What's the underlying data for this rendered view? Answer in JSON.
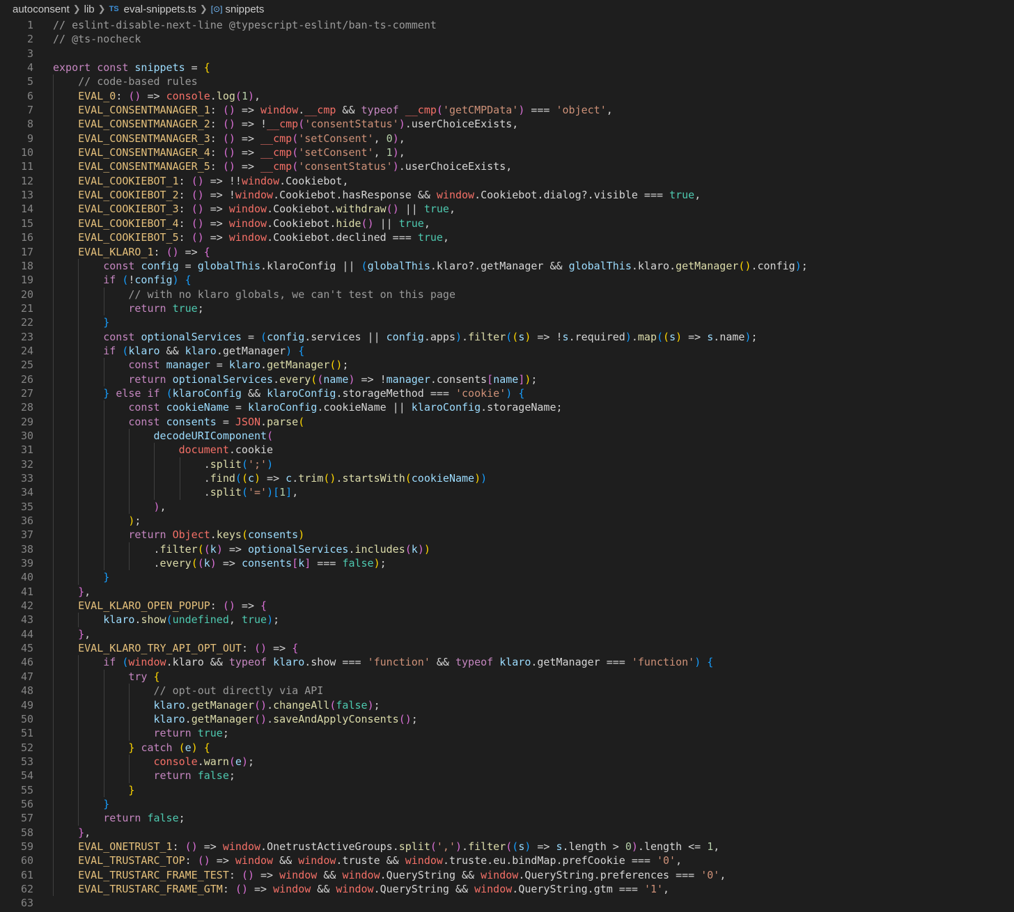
{
  "breadcrumb": {
    "items": [
      "autoconsent",
      "lib",
      "eval-snippets.ts",
      "snippets"
    ],
    "file_icon": "TS",
    "symbol_icon": "[⊙]"
  },
  "code_lines": [
    "// eslint-disable-next-line @typescript-eslint/ban-ts-comment",
    "// @ts-nocheck",
    "",
    "export const snippets = {",
    "    // code-based rules",
    "    EVAL_0: () => console.log(1),",
    "    EVAL_CONSENTMANAGER_1: () => window.__cmp && typeof __cmp('getCMPData') === 'object',",
    "    EVAL_CONSENTMANAGER_2: () => !__cmp('consentStatus').userChoiceExists,",
    "    EVAL_CONSENTMANAGER_3: () => __cmp('setConsent', 0),",
    "    EVAL_CONSENTMANAGER_4: () => __cmp('setConsent', 1),",
    "    EVAL_CONSENTMANAGER_5: () => __cmp('consentStatus').userChoiceExists,",
    "    EVAL_COOKIEBOT_1: () => !!window.Cookiebot,",
    "    EVAL_COOKIEBOT_2: () => !window.Cookiebot.hasResponse && window.Cookiebot.dialog?.visible === true,",
    "    EVAL_COOKIEBOT_3: () => window.Cookiebot.withdraw() || true,",
    "    EVAL_COOKIEBOT_4: () => window.Cookiebot.hide() || true,",
    "    EVAL_COOKIEBOT_5: () => window.Cookiebot.declined === true,",
    "    EVAL_KLARO_1: () => {",
    "        const config = globalThis.klaroConfig || (globalThis.klaro?.getManager && globalThis.klaro.getManager().config);",
    "        if (!config) {",
    "            // with no klaro globals, we can't test on this page",
    "            return true;",
    "        }",
    "        const optionalServices = (config.services || config.apps).filter((s) => !s.required).map((s) => s.name);",
    "        if (klaro && klaro.getManager) {",
    "            const manager = klaro.getManager();",
    "            return optionalServices.every((name) => !manager.consents[name]);",
    "        } else if (klaroConfig && klaroConfig.storageMethod === 'cookie') {",
    "            const cookieName = klaroConfig.cookieName || klaroConfig.storageName;",
    "            const consents = JSON.parse(",
    "                decodeURIComponent(",
    "                    document.cookie",
    "                        .split(';')",
    "                        .find((c) => c.trim().startsWith(cookieName))",
    "                        .split('=')[1],",
    "                ),",
    "            );",
    "            return Object.keys(consents)",
    "                .filter((k) => optionalServices.includes(k))",
    "                .every((k) => consents[k] === false);",
    "        }",
    "    },",
    "    EVAL_KLARO_OPEN_POPUP: () => {",
    "        klaro.show(undefined, true);",
    "    },",
    "    EVAL_KLARO_TRY_API_OPT_OUT: () => {",
    "        if (window.klaro && typeof klaro.show === 'function' && typeof klaro.getManager === 'function') {",
    "            try {",
    "                // opt-out directly via API",
    "                klaro.getManager().changeAll(false);",
    "                klaro.getManager().saveAndApplyConsents();",
    "                return true;",
    "            } catch (e) {",
    "                console.warn(e);",
    "                return false;",
    "            }",
    "        }",
    "        return false;",
    "    },",
    "    EVAL_ONETRUST_1: () => window.OnetrustActiveGroups.split(',').filter((s) => s.length > 0).length <= 1,",
    "    EVAL_TRUSTARC_TOP: () => window && window.truste && window.truste.eu.bindMap.prefCookie === '0',",
    "    EVAL_TRUSTARC_FRAME_TEST: () => window && window.QueryString && window.QueryString.preferences === '0',",
    "    EVAL_TRUSTARC_FRAME_GTM: () => window && window.QueryString && window.QueryString.gtm === '1',",
    ""
  ],
  "colors": {
    "background": "#1e1e1e",
    "line_number": "#858585",
    "comment": "#9a9a9a",
    "keyword": "#c586c0",
    "constant": "#e5c07b",
    "string": "#ce9178",
    "global": "#f47067",
    "boolean": "#4ec9b0"
  }
}
